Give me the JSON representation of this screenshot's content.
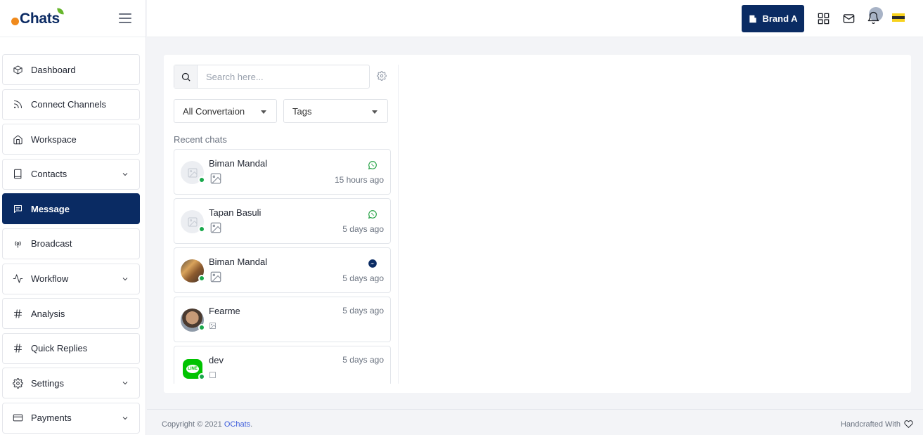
{
  "app": {
    "logo_text": "Chats"
  },
  "sidebar": {
    "items": [
      {
        "label": "Dashboard",
        "icon": "box-icon"
      },
      {
        "label": "Connect Channels",
        "icon": "rss-icon"
      },
      {
        "label": "Workspace",
        "icon": "home-icon"
      },
      {
        "label": "Contacts",
        "icon": "book-icon",
        "expandable": true
      },
      {
        "label": "Message",
        "icon": "message-icon",
        "active": true
      },
      {
        "label": "Broadcast",
        "icon": "broadcast-icon"
      },
      {
        "label": "Workflow",
        "icon": "activity-icon",
        "expandable": true
      },
      {
        "label": "Analysis",
        "icon": "hash-icon"
      },
      {
        "label": "Quick Replies",
        "icon": "hash-icon"
      },
      {
        "label": "Settings",
        "icon": "gear-icon",
        "expandable": true
      },
      {
        "label": "Payments",
        "icon": "card-icon",
        "expandable": true
      }
    ]
  },
  "topbar": {
    "brand_button": "Brand A",
    "icons": [
      "apps-grid-icon",
      "mail-icon",
      "bell-icon",
      "user-avatar",
      "flag-icon"
    ]
  },
  "chat": {
    "search_placeholder": "Search here...",
    "filter_conversation": "All Convertaion",
    "filter_tags": "Tags",
    "recent_label": "Recent chats",
    "items": [
      {
        "name": "Biman Mandal",
        "time": "15 hours ago",
        "channel": "whatsapp",
        "message_type": "image"
      },
      {
        "name": "Tapan Basuli",
        "time": "5 days ago",
        "channel": "whatsapp",
        "message_type": "image"
      },
      {
        "name": "Biman Mandal",
        "time": "5 days ago",
        "channel": "messenger",
        "message_type": "image"
      },
      {
        "name": "Fearme",
        "time": "5 days ago",
        "channel": "",
        "message_type": "image"
      },
      {
        "name": "dev",
        "time": "5 days ago",
        "channel": "line",
        "message_type": "image"
      }
    ]
  },
  "footer": {
    "copyright_prefix": "Copyright © 2021 ",
    "copyright_link": "OChats",
    "copyright_suffix": ".",
    "handcrafted": "Handcrafted With"
  },
  "colors": {
    "primary": "#0a2b63",
    "online": "#19a84b",
    "whatsapp": "#25a244",
    "messenger": "#0a2b63"
  }
}
